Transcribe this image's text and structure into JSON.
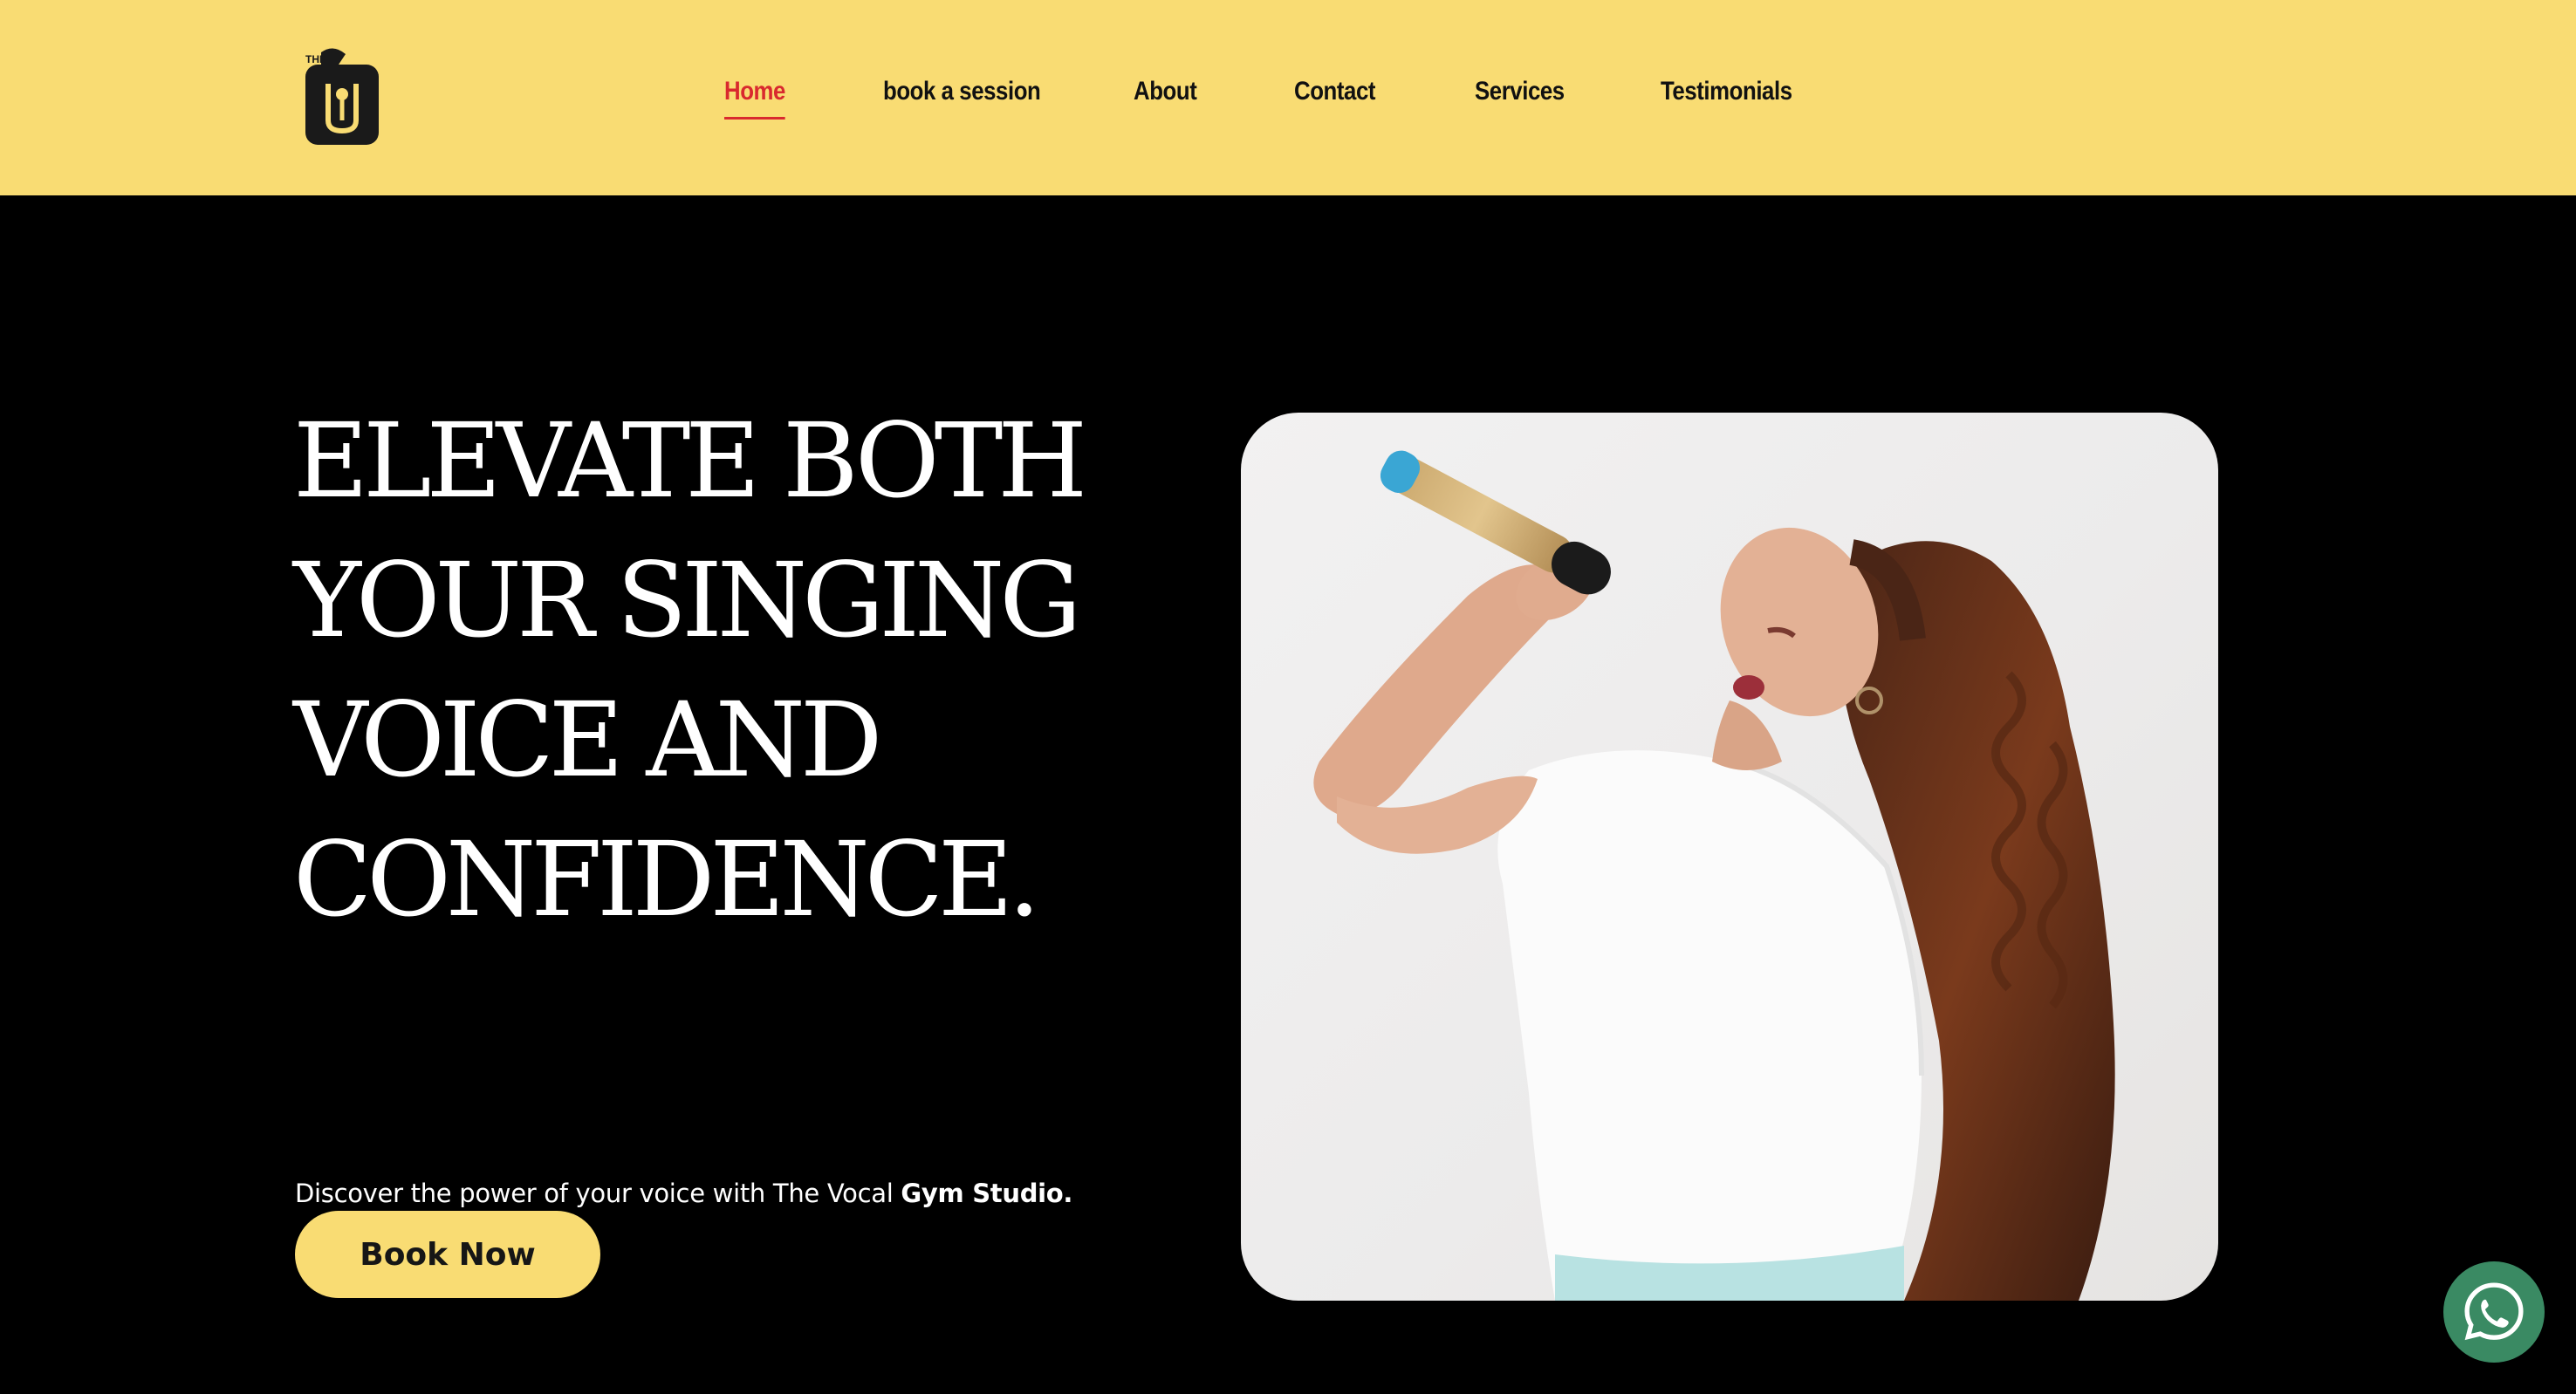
{
  "brand": {
    "logo_icon": "vocal-gym-logo-icon",
    "logo_text": "THE",
    "colors": {
      "header_bg": "#f9dc73",
      "page_bg": "#000000",
      "nav_active": "#d9292e",
      "button_bg": "#f9dc73",
      "whatsapp_bg": "#3a8a63"
    }
  },
  "nav": {
    "items": [
      {
        "label": "Home",
        "active": true
      },
      {
        "label": "book a session",
        "active": false
      },
      {
        "label": "About",
        "active": false
      },
      {
        "label": "Contact",
        "active": false
      },
      {
        "label": "Services",
        "active": false
      },
      {
        "label": "Testimonials",
        "active": false
      }
    ]
  },
  "hero": {
    "headline_lines": [
      "ELEVATE BOTH",
      "YOUR SINGING",
      "VOICE AND",
      "CONFIDENCE."
    ],
    "tagline_regular": "Discover the power of your voice with The Vocal ",
    "tagline_bold": "Gym Studio.",
    "cta_label": "Book Now",
    "image_subject": "woman singing into microphone"
  },
  "floating": {
    "whatsapp_icon": "whatsapp-icon"
  }
}
